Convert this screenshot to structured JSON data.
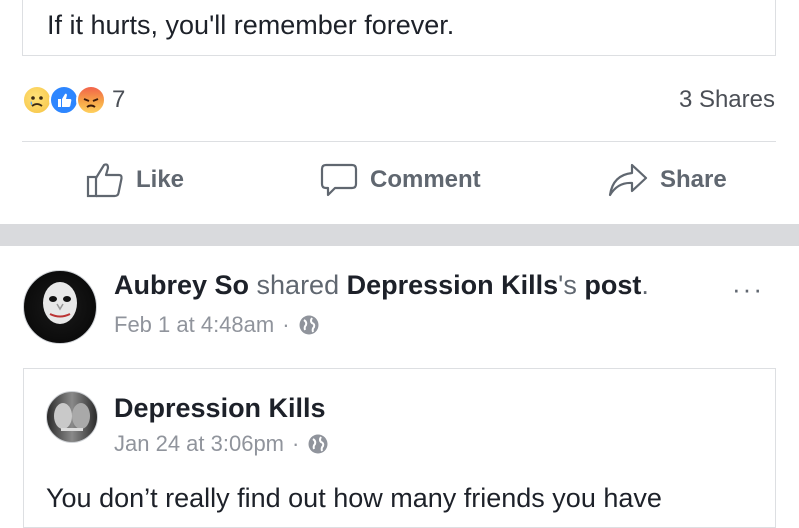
{
  "top_post": {
    "quote_text": "If it hurts, you'll remember forever.",
    "reaction_count": "7",
    "reaction_icons": [
      "sad-reaction-icon",
      "like-reaction-icon",
      "angry-reaction-icon"
    ],
    "shares": "3 Shares",
    "actions": {
      "like": "Like",
      "comment": "Comment",
      "share": "Share"
    }
  },
  "shared_post": {
    "author": "Aubrey So",
    "verb": " shared ",
    "source_page": "Depression Kills",
    "possessive": "'s ",
    "object": "post",
    "period": ".",
    "timestamp": "Feb 1 at 4:48am",
    "dot": "·",
    "more": "···",
    "original": {
      "author": "Depression Kills",
      "timestamp": "Jan 24 at 3:06pm",
      "dot": "·",
      "text": "You don’t really find out how many friends you have"
    }
  },
  "colors": {
    "text": "#1d2129",
    "secondary": "#606770",
    "muted": "#90949c",
    "divider": "#dddfe2",
    "feed_gap": "#d9dadd",
    "like_blue": "#2d86ff"
  }
}
